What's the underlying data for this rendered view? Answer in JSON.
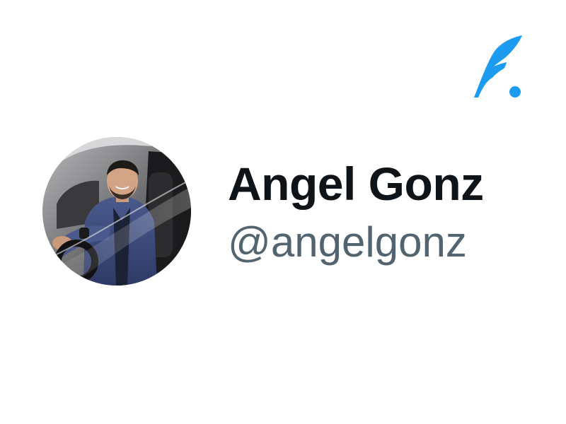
{
  "brand": {
    "logo_icon": "feather-quill-icon",
    "accent_color": "#1d9bf0"
  },
  "profile": {
    "avatar_icon": "avatar-photo",
    "display_name": "Angel Gonz",
    "handle": "@angelgonz",
    "name_color": "#0f1419",
    "handle_color": "#536471"
  }
}
